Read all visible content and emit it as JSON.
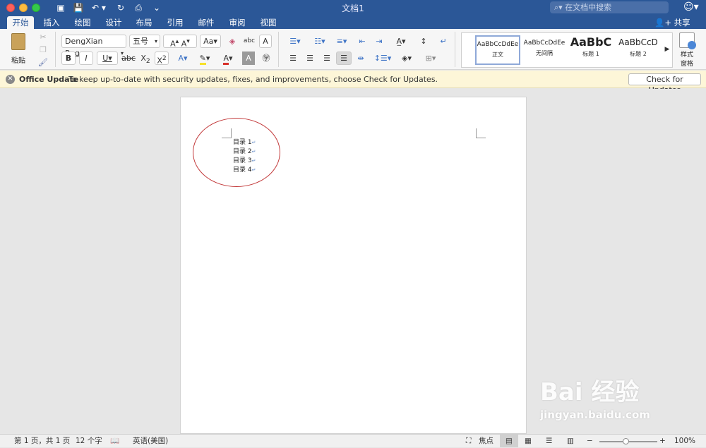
{
  "window": {
    "title": "文档1"
  },
  "search": {
    "placeholder": "在文档中搜索"
  },
  "tabs": [
    "开始",
    "插入",
    "绘图",
    "设计",
    "布局",
    "引用",
    "邮件",
    "审阅",
    "视图"
  ],
  "share_label": "共享",
  "ribbon": {
    "paste_label": "粘贴",
    "font_name": "DengXian Reg...",
    "font_size": "五号",
    "styles": [
      {
        "sample": "AaBbCcDdEe",
        "name": "正文"
      },
      {
        "sample": "AaBbCcDdEe",
        "name": "无间隔"
      },
      {
        "sample": "AaBbC",
        "name": "标题 1"
      },
      {
        "sample": "AaBbCcD",
        "name": "标题 2"
      }
    ],
    "styles_pane_label_1": "样式",
    "styles_pane_label_2": "窗格"
  },
  "infobar": {
    "title": "Office Update",
    "message": "To keep up-to-date with security updates, fixes, and improvements, choose Check for Updates.",
    "button": "Check for Updates"
  },
  "document": {
    "lines": [
      "目录 1",
      "目录 2",
      "目录 3",
      "目录 4"
    ],
    "paragraph_mark": "↵"
  },
  "status": {
    "page": "第 1 页，共 1 页",
    "words": "12 个字",
    "language": "英语(美国)",
    "focus": "焦点",
    "zoom": "100%"
  },
  "watermark": {
    "brand": "Bai 经验",
    "url": "jingyan.baidu.com"
  }
}
